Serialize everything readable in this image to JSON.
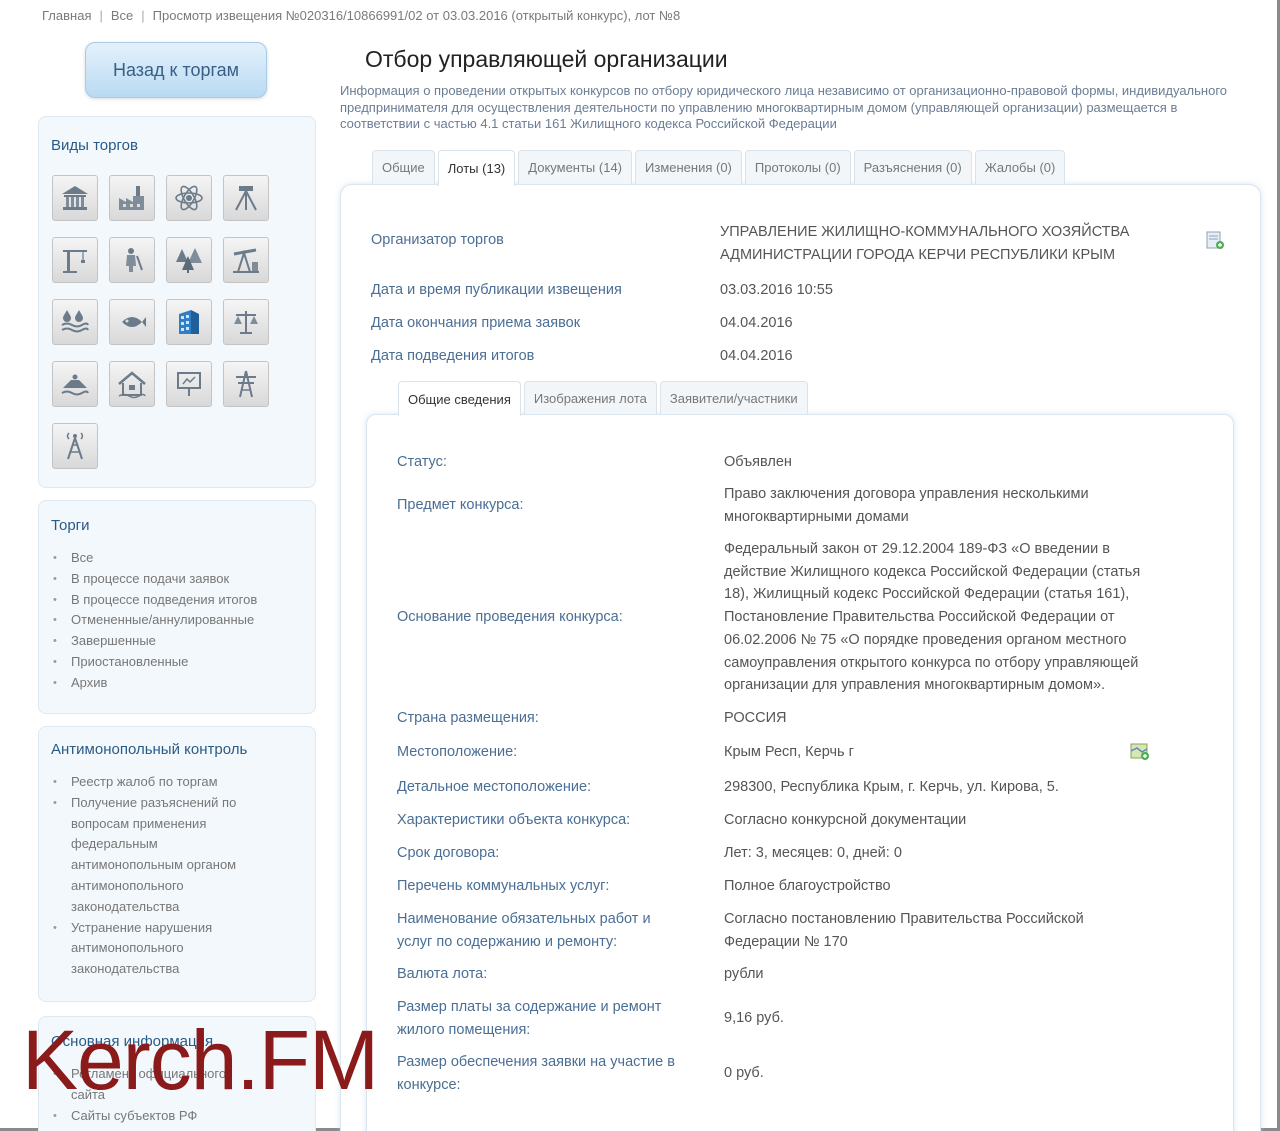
{
  "breadcrumb": {
    "home": "Главная",
    "all": "Все",
    "current": "Просмотр извещения №020316/10866991/02 от 03.03.2016 (открытый конкурс), лот №8"
  },
  "back_button": "Назад к торгам",
  "sidebar": {
    "types_title": "Виды торгов",
    "type_icons": [
      "bank-icon",
      "factory-icon",
      "atom-icon",
      "survey-icon",
      "crane-icon",
      "geologist-icon",
      "forest-icon",
      "oil-pump-icon",
      "water-icon",
      "fishing-icon",
      "building-icon",
      "scales-icon",
      "jetski-icon",
      "house-icon",
      "billboard-icon",
      "power-line-icon",
      "radio-tower-icon"
    ],
    "torgi_title": "Торги",
    "torgi_items": [
      "Все",
      "В процессе подачи заявок",
      "В процессе подведения итогов",
      "Отмененные/аннулированные",
      "Завершенные",
      "Приостановленные",
      "Архив"
    ],
    "anti_title": "Антимонопольный контроль",
    "anti_items": [
      {
        "lines": [
          "Реестр жалоб по торгам"
        ]
      },
      {
        "lines": [
          "Получение разъяснений по",
          "вопросам применения",
          "федеральным",
          "антимонопольным органом",
          "антимонопольного",
          "законодательства"
        ]
      },
      {
        "lines": [
          "Устранение нарушения",
          "антимонопольного",
          "законодательства"
        ]
      }
    ],
    "info_title": "Основная информация",
    "info_items": [
      {
        "lines": [
          "Регламент официального",
          "сайта"
        ]
      },
      {
        "lines": [
          "Сайты субъектов РФ"
        ]
      }
    ]
  },
  "main": {
    "title": "Отбор управляющей организации",
    "description": "Информация о проведении открытых конкурсов по отбору юридического лица независимо от организационно-правовой формы, индивидуального предпринимателя для осуществления деятельности по управлению многоквартирным домом (управляющей организации) размещается в соответствии с частью 4.1 статьи 161 Жилищного кодекса Российской Федерации",
    "tabs": [
      "Общие",
      "Лоты (13)",
      "Документы (14)",
      "Изменения (0)",
      "Протоколы (0)",
      "Разъяснения (0)",
      "Жалобы (0)"
    ],
    "organizer_label": "Организатор торгов",
    "organizer_line1": "УПРАВЛЕНИЕ ЖИЛИЩНО-КОММУНАЛЬНОГО ХОЗЯЙСТВА",
    "organizer_line2": "АДМИНИСТРАЦИИ ГОРОДА КЕРЧИ РЕСПУБЛИКИ КРЫМ",
    "pub_label": "Дата и время публикации извещения",
    "pub_value": "03.03.2016 10:55",
    "end_label": "Дата окончания приема заявок",
    "end_value": "04.04.2016",
    "results_label": "Дата подведения итогов",
    "results_value": "04.04.2016",
    "inner_tabs": [
      "Общие сведения",
      "Изображения лота",
      "Заявители/участники"
    ]
  },
  "lot": {
    "status_label": "Статус:",
    "status_value": "Объявлен",
    "subject_label": "Предмет конкурса:",
    "subject_value": [
      "Право заключения договора управления несколькими",
      "многоквартирными домами"
    ],
    "basis_label": "Основание проведения конкурса:",
    "basis_value": [
      "Федеральный закон от 29.12.2004 189-ФЗ «О введении в",
      "действие Жилищного кодекса Российской Федерации (статья",
      "18), Жилищный кодекс Российской Федерации (статья 161),",
      "Постановление Правительства Российской Федерации от",
      "06.02.2006 № 75 «О порядке проведения органом местного",
      "самоуправления открытого конкурса по отбору управляющей",
      "организации для управления многоквартирным домом»."
    ],
    "country_label": "Страна размещения:",
    "country_value": "РОССИЯ",
    "location_label": "Местоположение:",
    "location_value": "Крым Респ, Керчь г",
    "detail_label": "Детальное местоположение:",
    "detail_value": "298300, Республика Крым, г. Керчь, ул. Кирова, 5.",
    "chars_label": "Характеристики объекта конкурса:",
    "chars_value": "Согласно конкурсной документации",
    "term_label": "Срок договора:",
    "term_value": "Лет: 3, месяцев: 0, дней: 0",
    "services_label": "Перечень коммунальных услуг:",
    "services_value": "Полное благоустройство",
    "works_label": [
      "Наименование обязательных работ и",
      "услуг по содержанию и ремонту:"
    ],
    "works_value": [
      "Согласно постановлению Правительства Российской",
      "Федерации № 170"
    ],
    "currency_label": "Валюта лота:",
    "currency_value": "рубли",
    "fee_label": [
      "Размер платы за содержание и ремонт",
      "жилого помещения:"
    ],
    "fee_value": "9,16 руб.",
    "deposit_label": [
      "Размер обеспечения заявки на участие в",
      "конкурсе:"
    ],
    "deposit_value": "0 руб."
  },
  "watermark": "Kerch.FM"
}
